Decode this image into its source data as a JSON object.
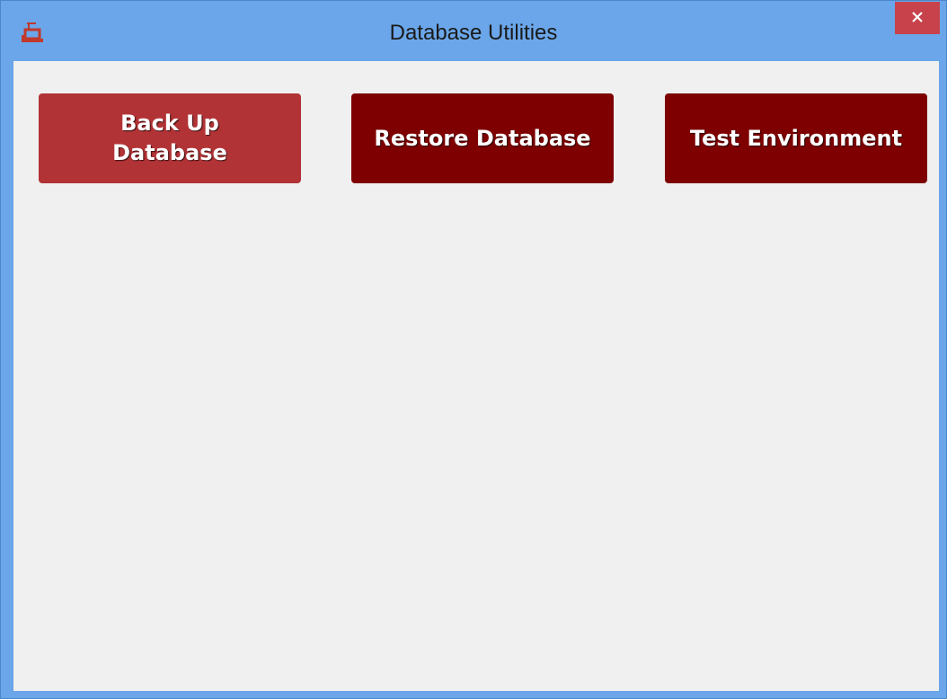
{
  "window": {
    "title": "Database Utilities",
    "icon": "database-tool-icon",
    "close_icon": "close-icon"
  },
  "colors": {
    "titlebar": "#6aa6e9",
    "client_background": "#f0f0f0",
    "close_button": "#c7424b",
    "button_active": "#b23336",
    "button_default": "#7e0000",
    "button_text": "#ffffff"
  },
  "actions": {
    "backup_label": "Back Up Database",
    "restore_label": "Restore Database",
    "test_label": "Test Environment"
  }
}
